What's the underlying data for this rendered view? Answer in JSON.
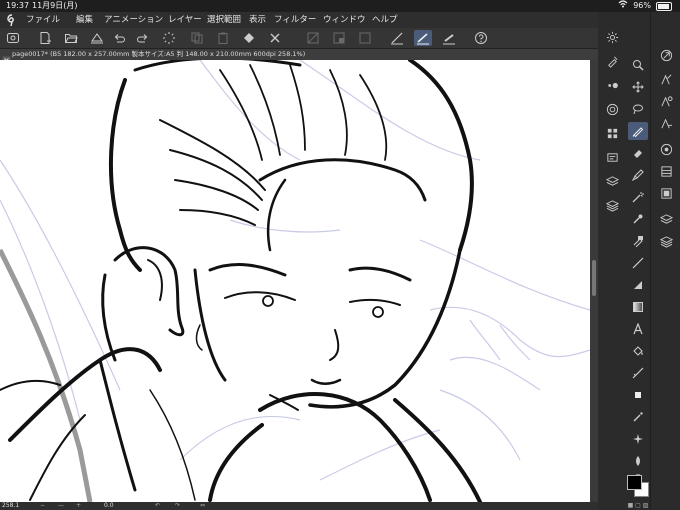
{
  "status_bar": {
    "time": "19:37",
    "date": "11月9日(月)",
    "battery": "96%",
    "wifi_icon": "wifi-icon",
    "battery_icon": "battery-icon"
  },
  "menu": {
    "app_icon": "clip-studio-icon",
    "items": [
      "ファイル",
      "編集",
      "アニメーション",
      "レイヤー",
      "選択範囲",
      "表示",
      "フィルター",
      "ウィンドウ",
      "ヘルプ"
    ]
  },
  "command_bar": {
    "icons": [
      "clip-studio-menu-icon",
      "new-file-icon",
      "open-file-icon",
      "save-icon",
      "undo-icon",
      "redo-icon",
      "loading-icon",
      "copy-icon",
      "paste-icon",
      "fill-icon",
      "clear-icon",
      "transform-icon",
      "deselect-icon",
      "invert-icon",
      "brush-stabilizer-1-icon",
      "brush-stabilizer-2-icon",
      "brush-stabilizer-3-icon",
      "help-icon"
    ],
    "active_icon": "brush-stabilizer-2-icon"
  },
  "document_tab": {
    "title": "page0017* (B5 182.00 x 257.00mm 製本サイズ:A5 判 148.00 x 210.00mm 600dpi 258.1%)"
  },
  "bottom_bar": {
    "zoom_value": "258.1",
    "angle_value": "0.0"
  },
  "palettes": [
    "gear-icon",
    "tool-property-icon",
    "brush-size-icon",
    "color-wheel-icon",
    "color-set-icon",
    "layer-property-icon",
    "layer-icon",
    "material-icon",
    "navigator-icon",
    "sub-view-icon",
    "search-icon"
  ],
  "tools": [
    "zoom-icon",
    "move-icon",
    "lasso-select-icon",
    "pen-icon",
    "eraser-icon",
    "brush-icon",
    "magic-wand-icon",
    "eyedropper-icon",
    "figure-icon",
    "line-icon",
    "frame-border-icon",
    "gradient-icon",
    "text-icon",
    "fill-bucket-icon",
    "ruler-icon",
    "vector-icon",
    "airbrush-icon",
    "decoration-icon",
    "blend-icon",
    "hand-icon",
    "rotate-icon"
  ],
  "layer_buttons": [
    "navigator-icon",
    "sub-tool-icon",
    "color-circle-icon",
    "layer-list-icon",
    "layer-stack-icon"
  ],
  "colors": {
    "main_color": "#000000",
    "sub_color": "#ffffff",
    "accent": "#4a5c7a"
  }
}
